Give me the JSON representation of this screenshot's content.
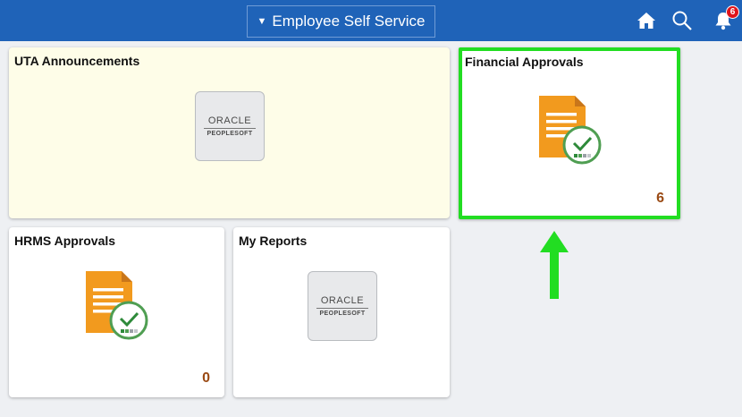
{
  "header": {
    "title": "Employee Self Service",
    "notification_count": "6"
  },
  "tiles": {
    "uta_announcements": {
      "title": "UTA Announcements",
      "logo_line1": "ORACLE",
      "logo_line2": "PEOPLESOFT",
      "background": "#fefde8"
    },
    "financial_approvals": {
      "title": "Financial Approvals",
      "count": "6",
      "highlight": "#22dd22"
    },
    "hrms_approvals": {
      "title": "HRMS Approvals",
      "count": "0"
    },
    "my_reports": {
      "title": "My Reports",
      "logo_line1": "ORACLE",
      "logo_line2": "PEOPLESOFT"
    }
  },
  "icons": [
    "home-icon",
    "search-icon",
    "bell-icon",
    "approval-doc-icon",
    "oracle-peoplesoft-logo",
    "up-arrow-icon"
  ],
  "colors": {
    "header": "#1f63b8",
    "doc_orange": "#f29a1e",
    "count": "#9a4a14",
    "badge": "#e0141b",
    "arrow": "#22dd22"
  }
}
